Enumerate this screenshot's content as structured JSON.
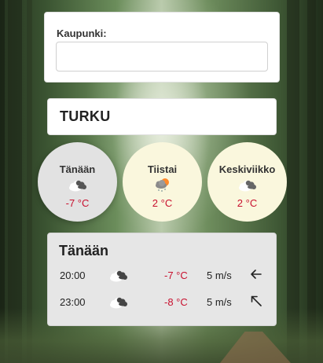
{
  "search": {
    "label": "Kaupunki:",
    "value": "",
    "placeholder": ""
  },
  "city": {
    "name": "TURKU"
  },
  "days": [
    {
      "name": "Tänään",
      "temp": "-7 °C",
      "icon": "cloudy-night-icon",
      "active": true
    },
    {
      "name": "Tiistai",
      "temp": "2 °C",
      "icon": "snow-shower-icon",
      "active": false
    },
    {
      "name": "Keskiviikko",
      "temp": "2 °C",
      "icon": "cloudy-icon",
      "active": false
    }
  ],
  "detail": {
    "title": "Tänään",
    "rows": [
      {
        "time": "20:00",
        "icon": "cloudy-night-icon",
        "temp": "-7 °C",
        "wind": "5 m/s",
        "direction_icon": "arrow-left-icon"
      },
      {
        "time": "23:00",
        "icon": "cloudy-night-icon",
        "temp": "-8 °C",
        "wind": "5 m/s",
        "direction_icon": "arrow-up-left-icon"
      }
    ]
  },
  "colors": {
    "temperature": "#c8102e",
    "day_bubble": "#faf7dd",
    "active_day_bubble": "#e2e2e2"
  }
}
